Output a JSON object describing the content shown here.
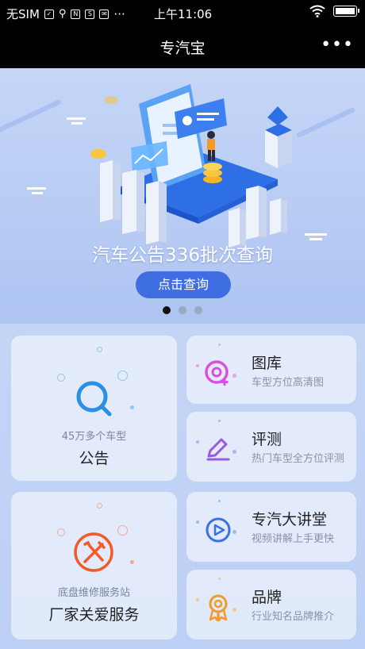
{
  "statusbar": {
    "carrier": "无SIM",
    "time": "上午11:06"
  },
  "header": {
    "title": "专汽宝",
    "more_label": "•••"
  },
  "banner": {
    "title": "汽车公告336批次查询",
    "button": "点击查询",
    "slides": 3,
    "active_slide": 1
  },
  "cards": {
    "announcement": {
      "sub": "45万多个车型",
      "name": "公告"
    },
    "service": {
      "sub": "底盘维修服务站",
      "name": "厂家关爱服务"
    },
    "gallery": {
      "name": "图库",
      "desc": "车型方位高清图"
    },
    "review": {
      "name": "评测",
      "desc": "热门车型全方位评测"
    },
    "lecture": {
      "name": "专汽大讲堂",
      "desc": "视频讲解上手更快"
    },
    "brand": {
      "name": "品牌",
      "desc": "行业知名品牌推介"
    }
  },
  "colors": {
    "accent": "#3f6ee3",
    "announcement_icon": "#2b8fe8",
    "service_icon": "#f25a2a",
    "gallery_icon": "#d94fe0",
    "review_icon": "#9b59e0",
    "lecture_icon": "#3a6fe5",
    "brand_icon": "#f29a2a"
  }
}
